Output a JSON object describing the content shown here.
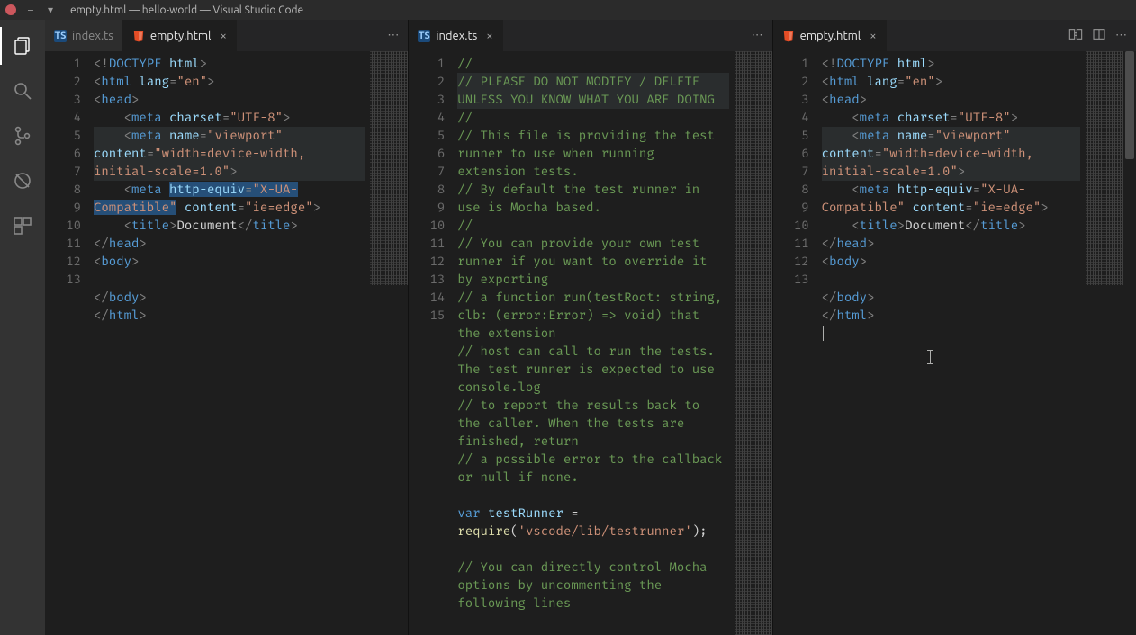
{
  "window": {
    "title": "empty.html — hello-world — Visual Studio Code"
  },
  "activitybar": {
    "items": [
      {
        "name": "explorer-icon"
      },
      {
        "name": "search-icon"
      },
      {
        "name": "scm-icon"
      },
      {
        "name": "debug-icon"
      },
      {
        "name": "extensions-icon"
      }
    ]
  },
  "groups": [
    {
      "tabs": [
        {
          "label": "index.ts",
          "filetype": "ts",
          "active": false,
          "closeable": false
        },
        {
          "label": "empty.html",
          "filetype": "html",
          "active": true,
          "closeable": true
        }
      ],
      "toolbar": {
        "more": "⋯"
      }
    },
    {
      "tabs": [
        {
          "label": "index.ts",
          "filetype": "ts",
          "active": true,
          "closeable": true
        }
      ],
      "toolbar": {
        "more": "⋯"
      }
    },
    {
      "tabs": [
        {
          "label": "empty.html",
          "filetype": "html",
          "active": true,
          "closeable": true
        }
      ],
      "toolbar": {
        "compare": "⇆",
        "split": "▥",
        "more": "⋯"
      }
    }
  ],
  "files": {
    "empty_html": {
      "lang": "html",
      "lines": [
        "<!DOCTYPE html>",
        "<html lang=\"en\">",
        "<head>",
        "    <meta charset=\"UTF-8\">",
        "    <meta name=\"viewport\" content=\"width=device-width, initial-scale=1.0\">",
        "    <meta http-equiv=\"X-UA-Compatible\" content=\"ie=edge\">",
        "    <title>Document</title>",
        "</head>",
        "<body>",
        "",
        "</body>",
        "</html>",
        ""
      ],
      "gutter_count": 13
    },
    "index_ts": {
      "lang": "ts",
      "lines": [
        "//",
        "// PLEASE DO NOT MODIFY / DELETE UNLESS YOU KNOW WHAT YOU ARE DOING",
        "//",
        "// This file is providing the test runner to use when running extension tests.",
        "// By default the test runner in use is Mocha based.",
        "//",
        "// You can provide your own test runner if you want to override it by exporting",
        "// a function run(testRoot: string, clb: (error:Error) => void) that the extension",
        "// host can call to run the tests. The test runner is expected to use console.log",
        "// to report the results back to the caller. When the tests are finished, return",
        "// a possible error to the callback or null if none.",
        "",
        "var testRunner = require('vscode/lib/testrunner');",
        "",
        "// You can directly control Mocha options by uncommenting the following lines"
      ],
      "gutter_count": 15
    }
  },
  "highlights": {
    "group_first": {
      "current_line_bg": 5,
      "selection_text": "http-equiv=\"X-UA-Compatible\""
    },
    "group_middle": {
      "current_line_bg": 2
    },
    "group_last": {
      "current_line_bg": 5,
      "cursor_line": 13
    }
  }
}
